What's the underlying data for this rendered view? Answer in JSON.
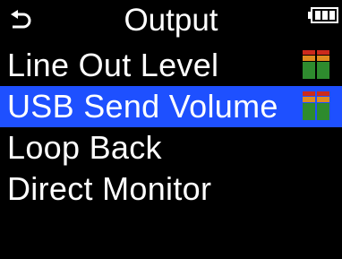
{
  "header": {
    "title": "Output",
    "back_icon": "back-arrow-icon",
    "battery_icon": "battery-icon"
  },
  "menu": {
    "items": [
      {
        "label": "Line Out Level",
        "icon": "level-meter-icon",
        "selected": false
      },
      {
        "label": "USB Send Volume",
        "icon": "level-meter-icon",
        "selected": true
      },
      {
        "label": "Loop Back",
        "selected": false
      },
      {
        "label": "Direct Monitor",
        "selected": false
      }
    ]
  },
  "colors": {
    "background": "#000000",
    "selection": "#1e50ff",
    "text": "#ffffff",
    "meter_red": "#cc2a1c",
    "meter_orange": "#e08a1e",
    "meter_green": "#2e8b2e"
  }
}
